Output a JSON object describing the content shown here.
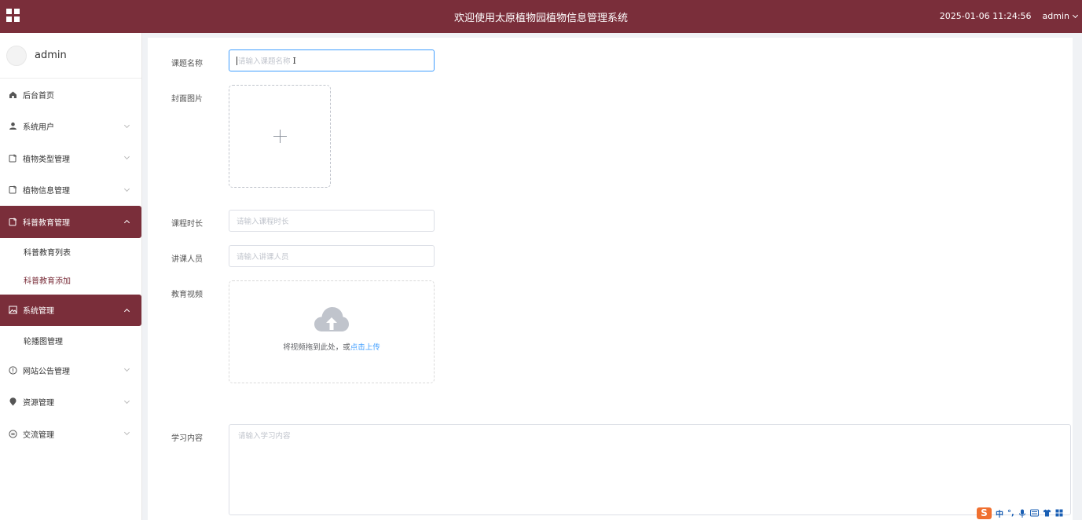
{
  "header": {
    "title": "欢迎使用太原植物园植物信息管理系统",
    "datetime": "2025-01-06 11:24:56",
    "user": "admin",
    "menu_icon": "grid-icon"
  },
  "sidebar": {
    "profile_name": "admin",
    "items": [
      {
        "label": "后台首页",
        "icon": "home-icon"
      },
      {
        "label": "系统用户",
        "icon": "user-icon"
      },
      {
        "label": "植物类型管理",
        "icon": "document-icon"
      },
      {
        "label": "植物信息管理",
        "icon": "document-icon"
      },
      {
        "label": "科普教育管理",
        "icon": "document-icon",
        "expanded": true
      },
      {
        "label": "系统管理",
        "icon": "image-icon",
        "expanded": true
      },
      {
        "label": "网站公告管理",
        "icon": "info-icon"
      },
      {
        "label": "资源管理",
        "icon": "location-icon"
      },
      {
        "label": "交流管理",
        "icon": "chat-icon"
      }
    ],
    "sub_science": [
      "科普教育列表",
      "科普教育添加"
    ],
    "sub_system": [
      "轮播图管理"
    ]
  },
  "form": {
    "title_label": "课题名称",
    "title_placeholder": "请输入课题名称",
    "cover_label": "封面图片",
    "duration_label": "课程时长",
    "duration_placeholder": "请输入课程时长",
    "lecturer_label": "讲课人员",
    "lecturer_placeholder": "请输入讲课人员",
    "video_label": "教育视频",
    "video_hint": "将视频拖到此处，或",
    "video_link": "点击上传",
    "content_label": "学习内容",
    "content_placeholder": "请输入学习内容"
  },
  "ime": {
    "logo": "S",
    "lang": "中",
    "punct": "°,",
    "icons": [
      "mic-icon",
      "keyboard-icon",
      "shirt-icon",
      "apps-icon"
    ]
  },
  "colors": {
    "primary": "#7a2e3a",
    "link": "#409eff"
  }
}
